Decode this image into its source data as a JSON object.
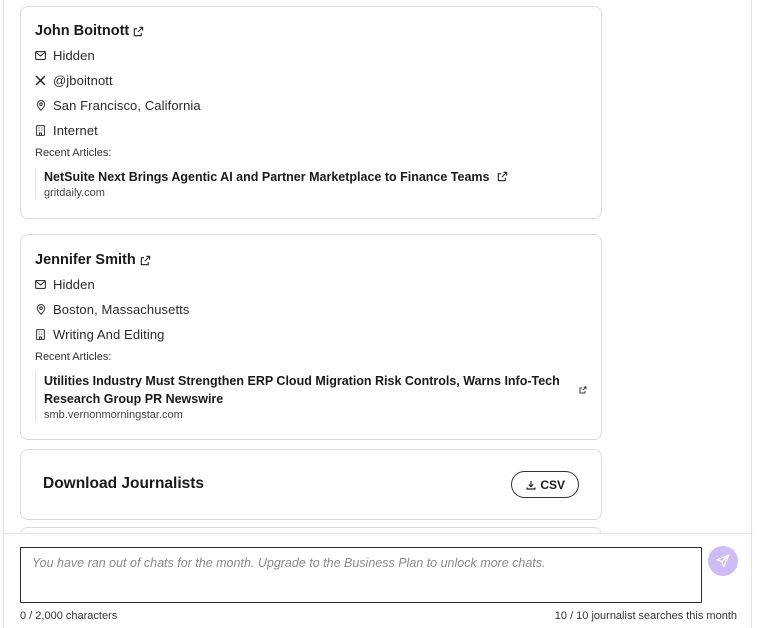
{
  "journalists": [
    {
      "name": "John Boitnott",
      "email": "Hidden",
      "twitter": "@jboitnott",
      "location": "San Francisco, California",
      "industry": "Internet",
      "recent_label": "Recent Articles:",
      "articles": [
        {
          "title": "NetSuite Next Brings Agentic AI and Partner Marketplace to Finance Teams",
          "domain": "gritdaily.com"
        }
      ]
    },
    {
      "name": "Jennifer Smith",
      "email": "Hidden",
      "location": "Boston, Massachusetts",
      "industry": "Writing And Editing",
      "recent_label": "Recent Articles:",
      "articles": [
        {
          "title": "Utilities Industry Must Strengthen ERP Cloud Migration Risk Controls, Warns Info-Tech Research Group PR Newswire",
          "domain": "smb.vernonmorningstar.com"
        }
      ]
    }
  ],
  "download": {
    "title": "Download Journalists",
    "csv_label": "CSV"
  },
  "composer": {
    "placeholder": "You have ran out of chats for the month. Upgrade to the Business Plan to unlock more chats.",
    "char_count": "0 / 2,000 characters",
    "search_count": "10 / 10 journalist searches this month"
  },
  "icons": {
    "email": "mail-icon",
    "twitter": "x-logo-icon",
    "location": "map-pin-icon",
    "industry": "building-icon",
    "external": "external-link-icon",
    "download": "download-icon",
    "send": "send-icon"
  },
  "colors": {
    "send_button": "#cdbcf5",
    "card_border": "#dcdcdc"
  }
}
